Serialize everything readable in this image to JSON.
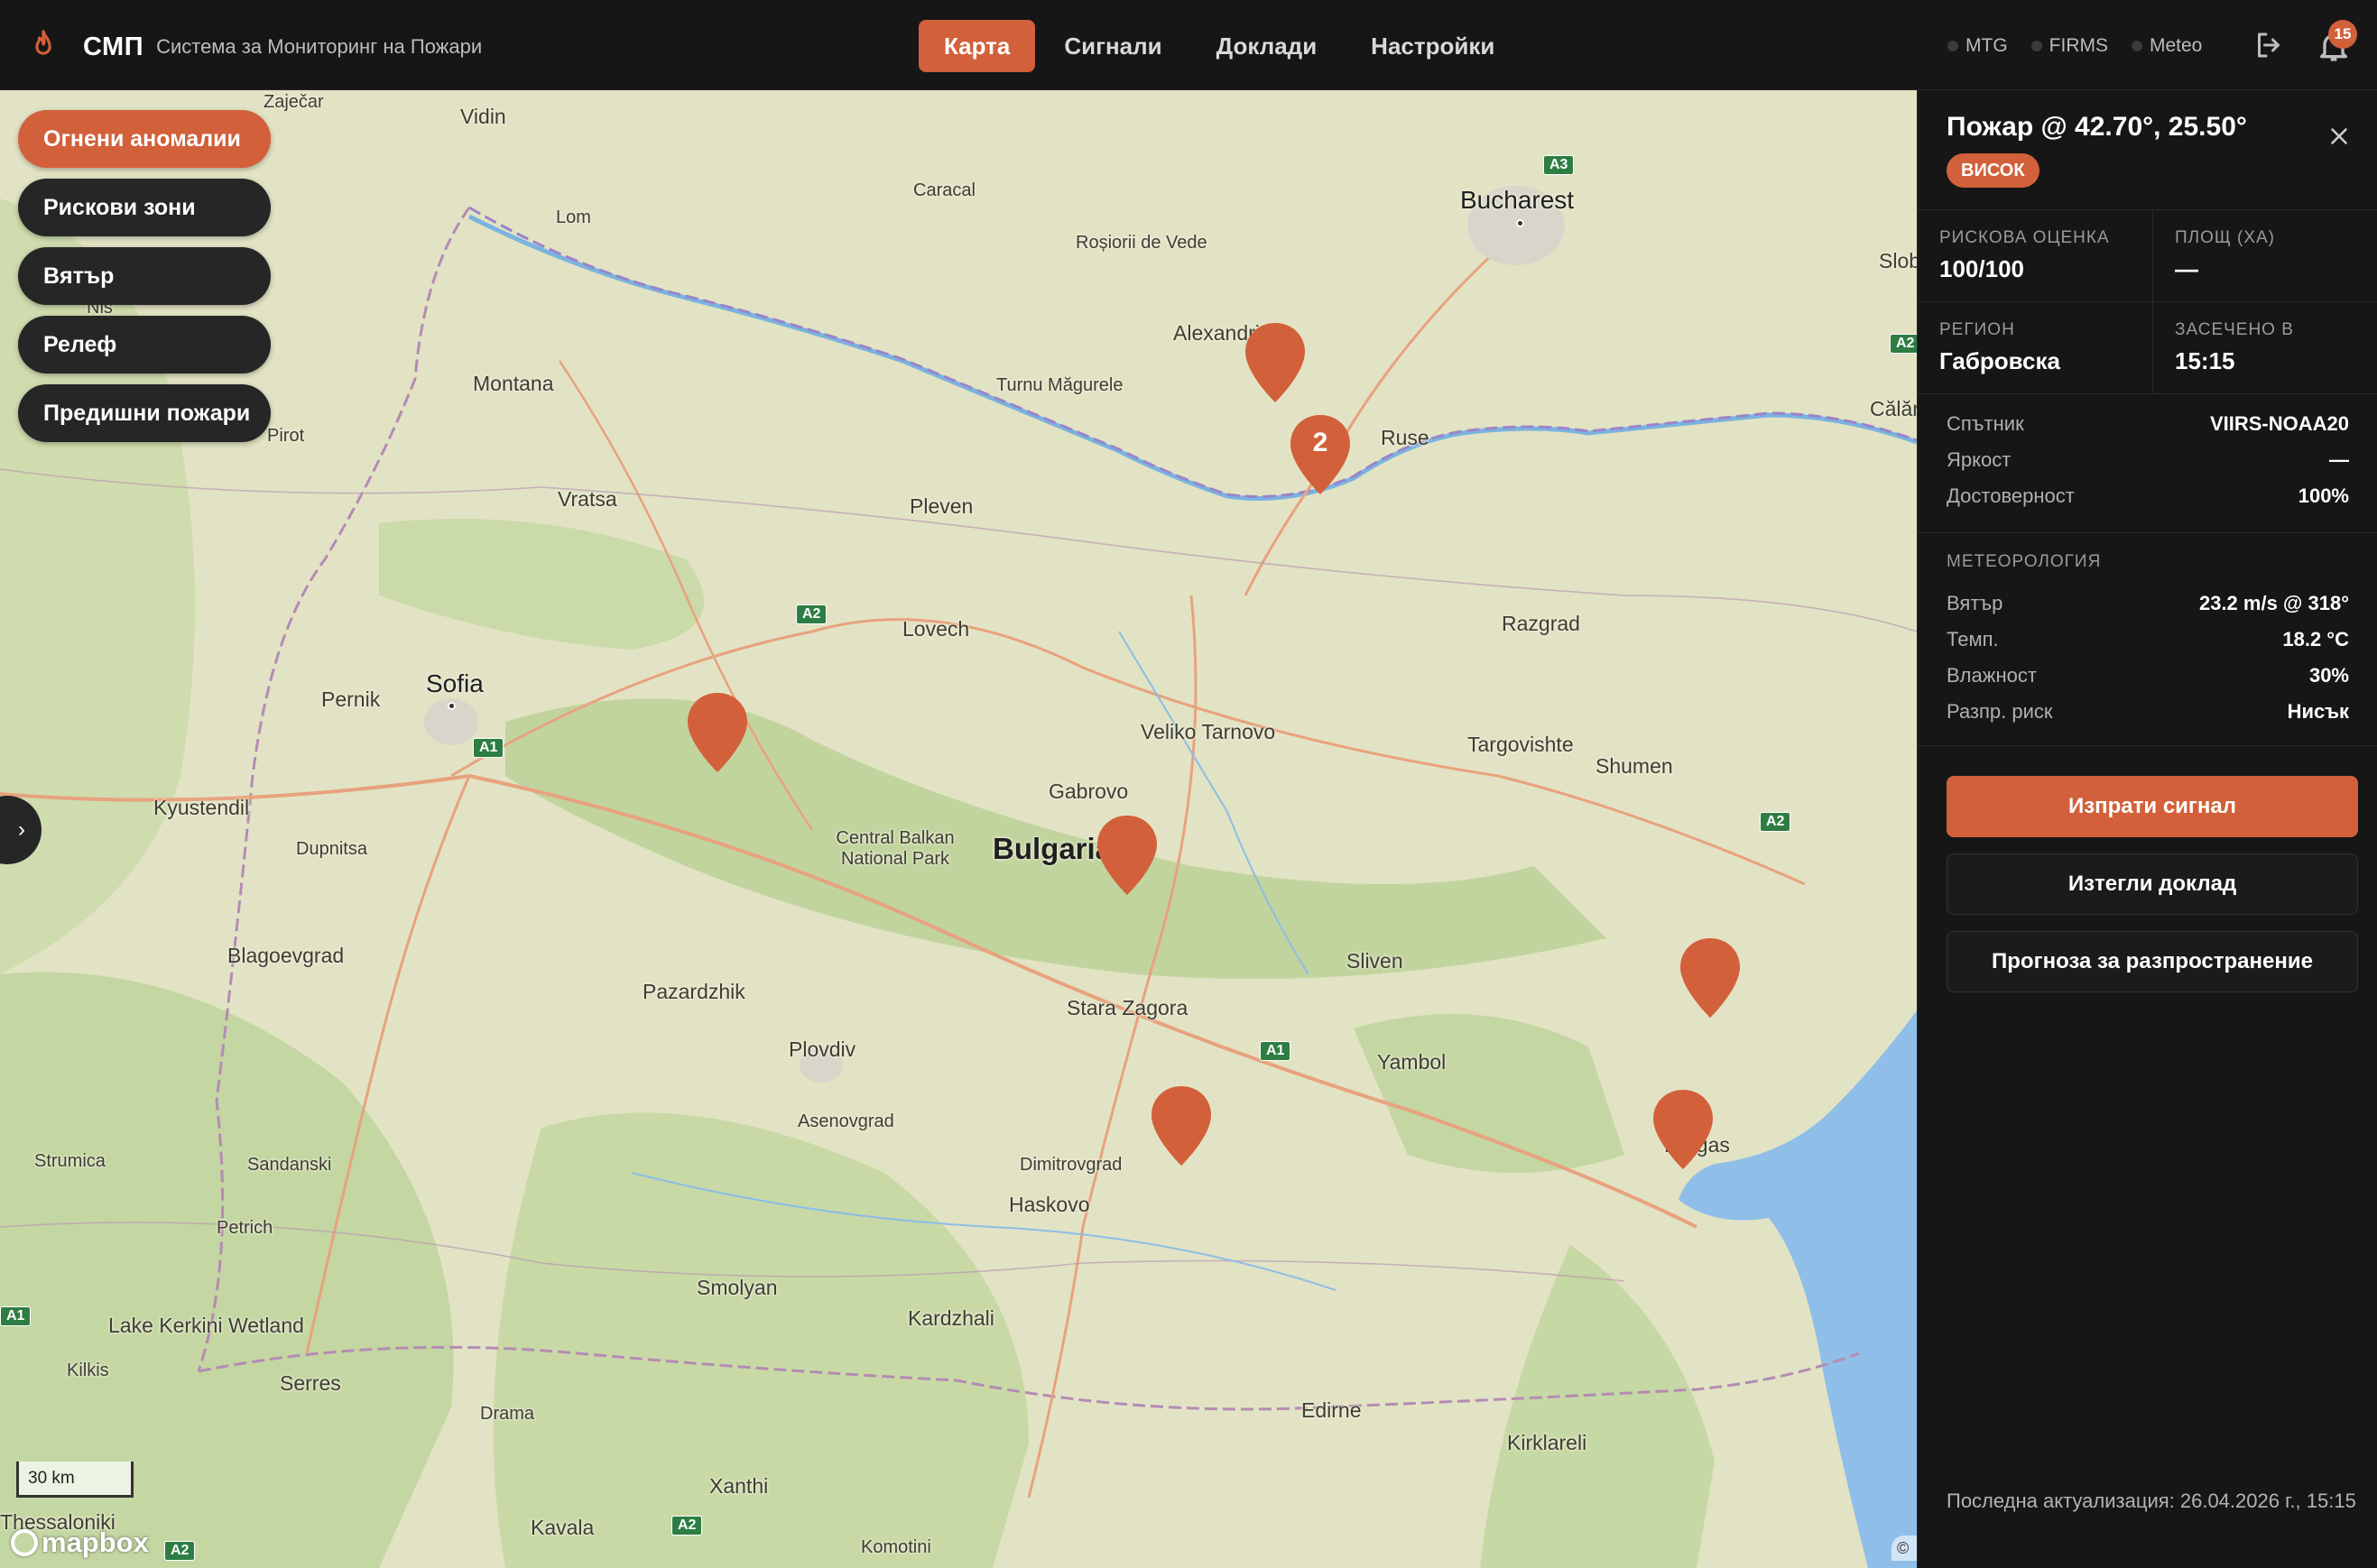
{
  "app": {
    "short_name": "СМП",
    "full_name": "Система за Мониторинг на Пожари"
  },
  "nav": {
    "tabs": [
      {
        "label": "Карта",
        "active": true
      },
      {
        "label": "Сигнали",
        "active": false
      },
      {
        "label": "Доклади",
        "active": false
      },
      {
        "label": "Настройки",
        "active": false
      }
    ]
  },
  "status": {
    "sources": [
      "MTG",
      "FIRMS",
      "Meteo"
    ],
    "notification_count": "15"
  },
  "layers": [
    {
      "label": "Огнени аномалии",
      "active": true
    },
    {
      "label": "Рискови зони",
      "active": false
    },
    {
      "label": "Вятър",
      "active": false
    },
    {
      "label": "Релеф",
      "active": false
    },
    {
      "label": "Предишни пожари",
      "active": false
    }
  ],
  "map": {
    "country_label": "Bulgaria",
    "cities": [
      "Bucharest",
      "Vidin",
      "Zaječar",
      "Lom",
      "Caracal",
      "Roșiorii de Vede",
      "Alexandria",
      "Turnu Măgurele",
      "Ruse",
      "Călărași",
      "Slobozia",
      "Montana",
      "Pirot",
      "Niš",
      "Vratsa",
      "Pleven",
      "Lovech",
      "Razgrad",
      "Sofia",
      "Pernik",
      "Veliko Tarnovo",
      "Targovishte",
      "Shumen",
      "Kyustendil",
      "Gabrovo",
      "Dupnitsa",
      "Central Balkan National Park",
      "Sliven",
      "Blagoevgrad",
      "Pazardzhik",
      "Stara Zagora",
      "Yambol",
      "Plovdiv",
      "Asenovgrad",
      "Burgas",
      "Strumica",
      "Sandanski",
      "Dimitrovgrad",
      "Haskovo",
      "Petrich",
      "Lake Kerkini Wetland",
      "Smolyan",
      "Kardzhali",
      "Kilkis",
      "Serres",
      "Drama",
      "Edirne",
      "Kirklareli",
      "Xanthi",
      "Kavala",
      "Thessaloniki",
      "Komotini"
    ],
    "road_shields": [
      "A3",
      "A2",
      "A2",
      "A1",
      "A2",
      "A1",
      "A1",
      "A2",
      "A2"
    ],
    "cluster_count": "2",
    "scale_label": "30 km",
    "attribution_logo": "mapbox",
    "attribution_mark": "©",
    "pin_color": "#d2603a"
  },
  "detail": {
    "title": "Пожар @ 42.70°, 25.50°",
    "severity": "ВИСОК",
    "risk_label": "РИСКОВА ОЦЕНКА",
    "risk_value": "100/100",
    "area_label": "ПЛОЩ (ХА)",
    "area_value": "—",
    "region_label": "РЕГИОН",
    "region_value": "Габровска",
    "detected_label": "ЗАСЕЧЕНО В",
    "detected_value": "15:15",
    "info": [
      {
        "k": "Спътник",
        "v": "VIIRS-NOAA20"
      },
      {
        "k": "Яркост",
        "v": "—"
      },
      {
        "k": "Достоверност",
        "v": "100%"
      }
    ],
    "meteo_heading": "МЕТЕОРОЛОГИЯ",
    "meteo": [
      {
        "k": "Вятър",
        "v": "23.2 m/s @ 318°"
      },
      {
        "k": "Темп.",
        "v": "18.2 °C"
      },
      {
        "k": "Влажност",
        "v": "30%"
      },
      {
        "k": "Разпр. риск",
        "v": "Нисък"
      }
    ],
    "actions": {
      "send_alert": "Изпрати сигнал",
      "download_report": "Изтегли доклад",
      "spread_forecast": "Прогноза за разпространение"
    },
    "last_update": "Последна актуализация: 26.04.2026 г., 15:15"
  },
  "colors": {
    "accent": "#d2603a",
    "background": "#161616"
  }
}
